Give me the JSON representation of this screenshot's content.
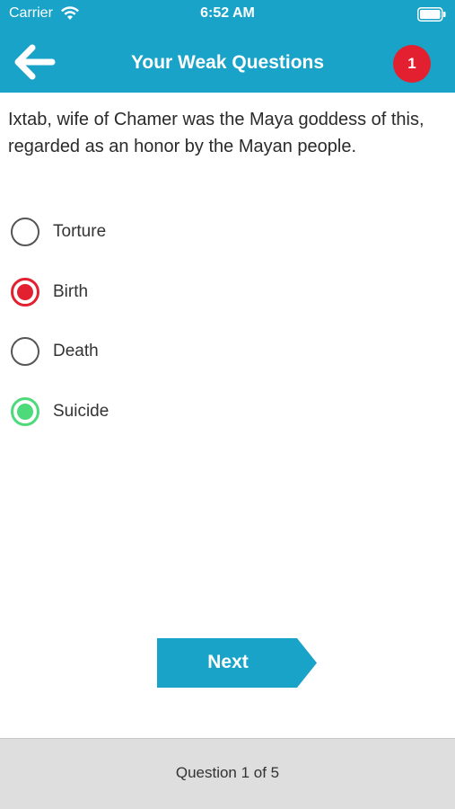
{
  "status_bar": {
    "carrier": "Carrier",
    "time": "6:52 AM",
    "icons": [
      "wifi-icon",
      "battery-icon"
    ]
  },
  "nav": {
    "back_icon": "arrow-left-icon",
    "title": "Your Weak Questions",
    "badge_count": "1"
  },
  "question": {
    "text": "Ixtab, wife of Chamer was the Maya goddess of this, regarded as an honor by the Mayan people."
  },
  "options": [
    {
      "label": "Torture",
      "state": "unselected"
    },
    {
      "label": "Birth",
      "state": "selected-wrong"
    },
    {
      "label": "Death",
      "state": "unselected"
    },
    {
      "label": "Suicide",
      "state": "correct"
    }
  ],
  "next_button": {
    "label": "Next"
  },
  "footer": {
    "progress_text": "Question 1 of 5"
  },
  "colors": {
    "accent": "#1aa3c8",
    "badge": "#e3202f",
    "wrong": "#e3202f",
    "correct": "#4dda7a",
    "footer_bg": "#dedede"
  }
}
